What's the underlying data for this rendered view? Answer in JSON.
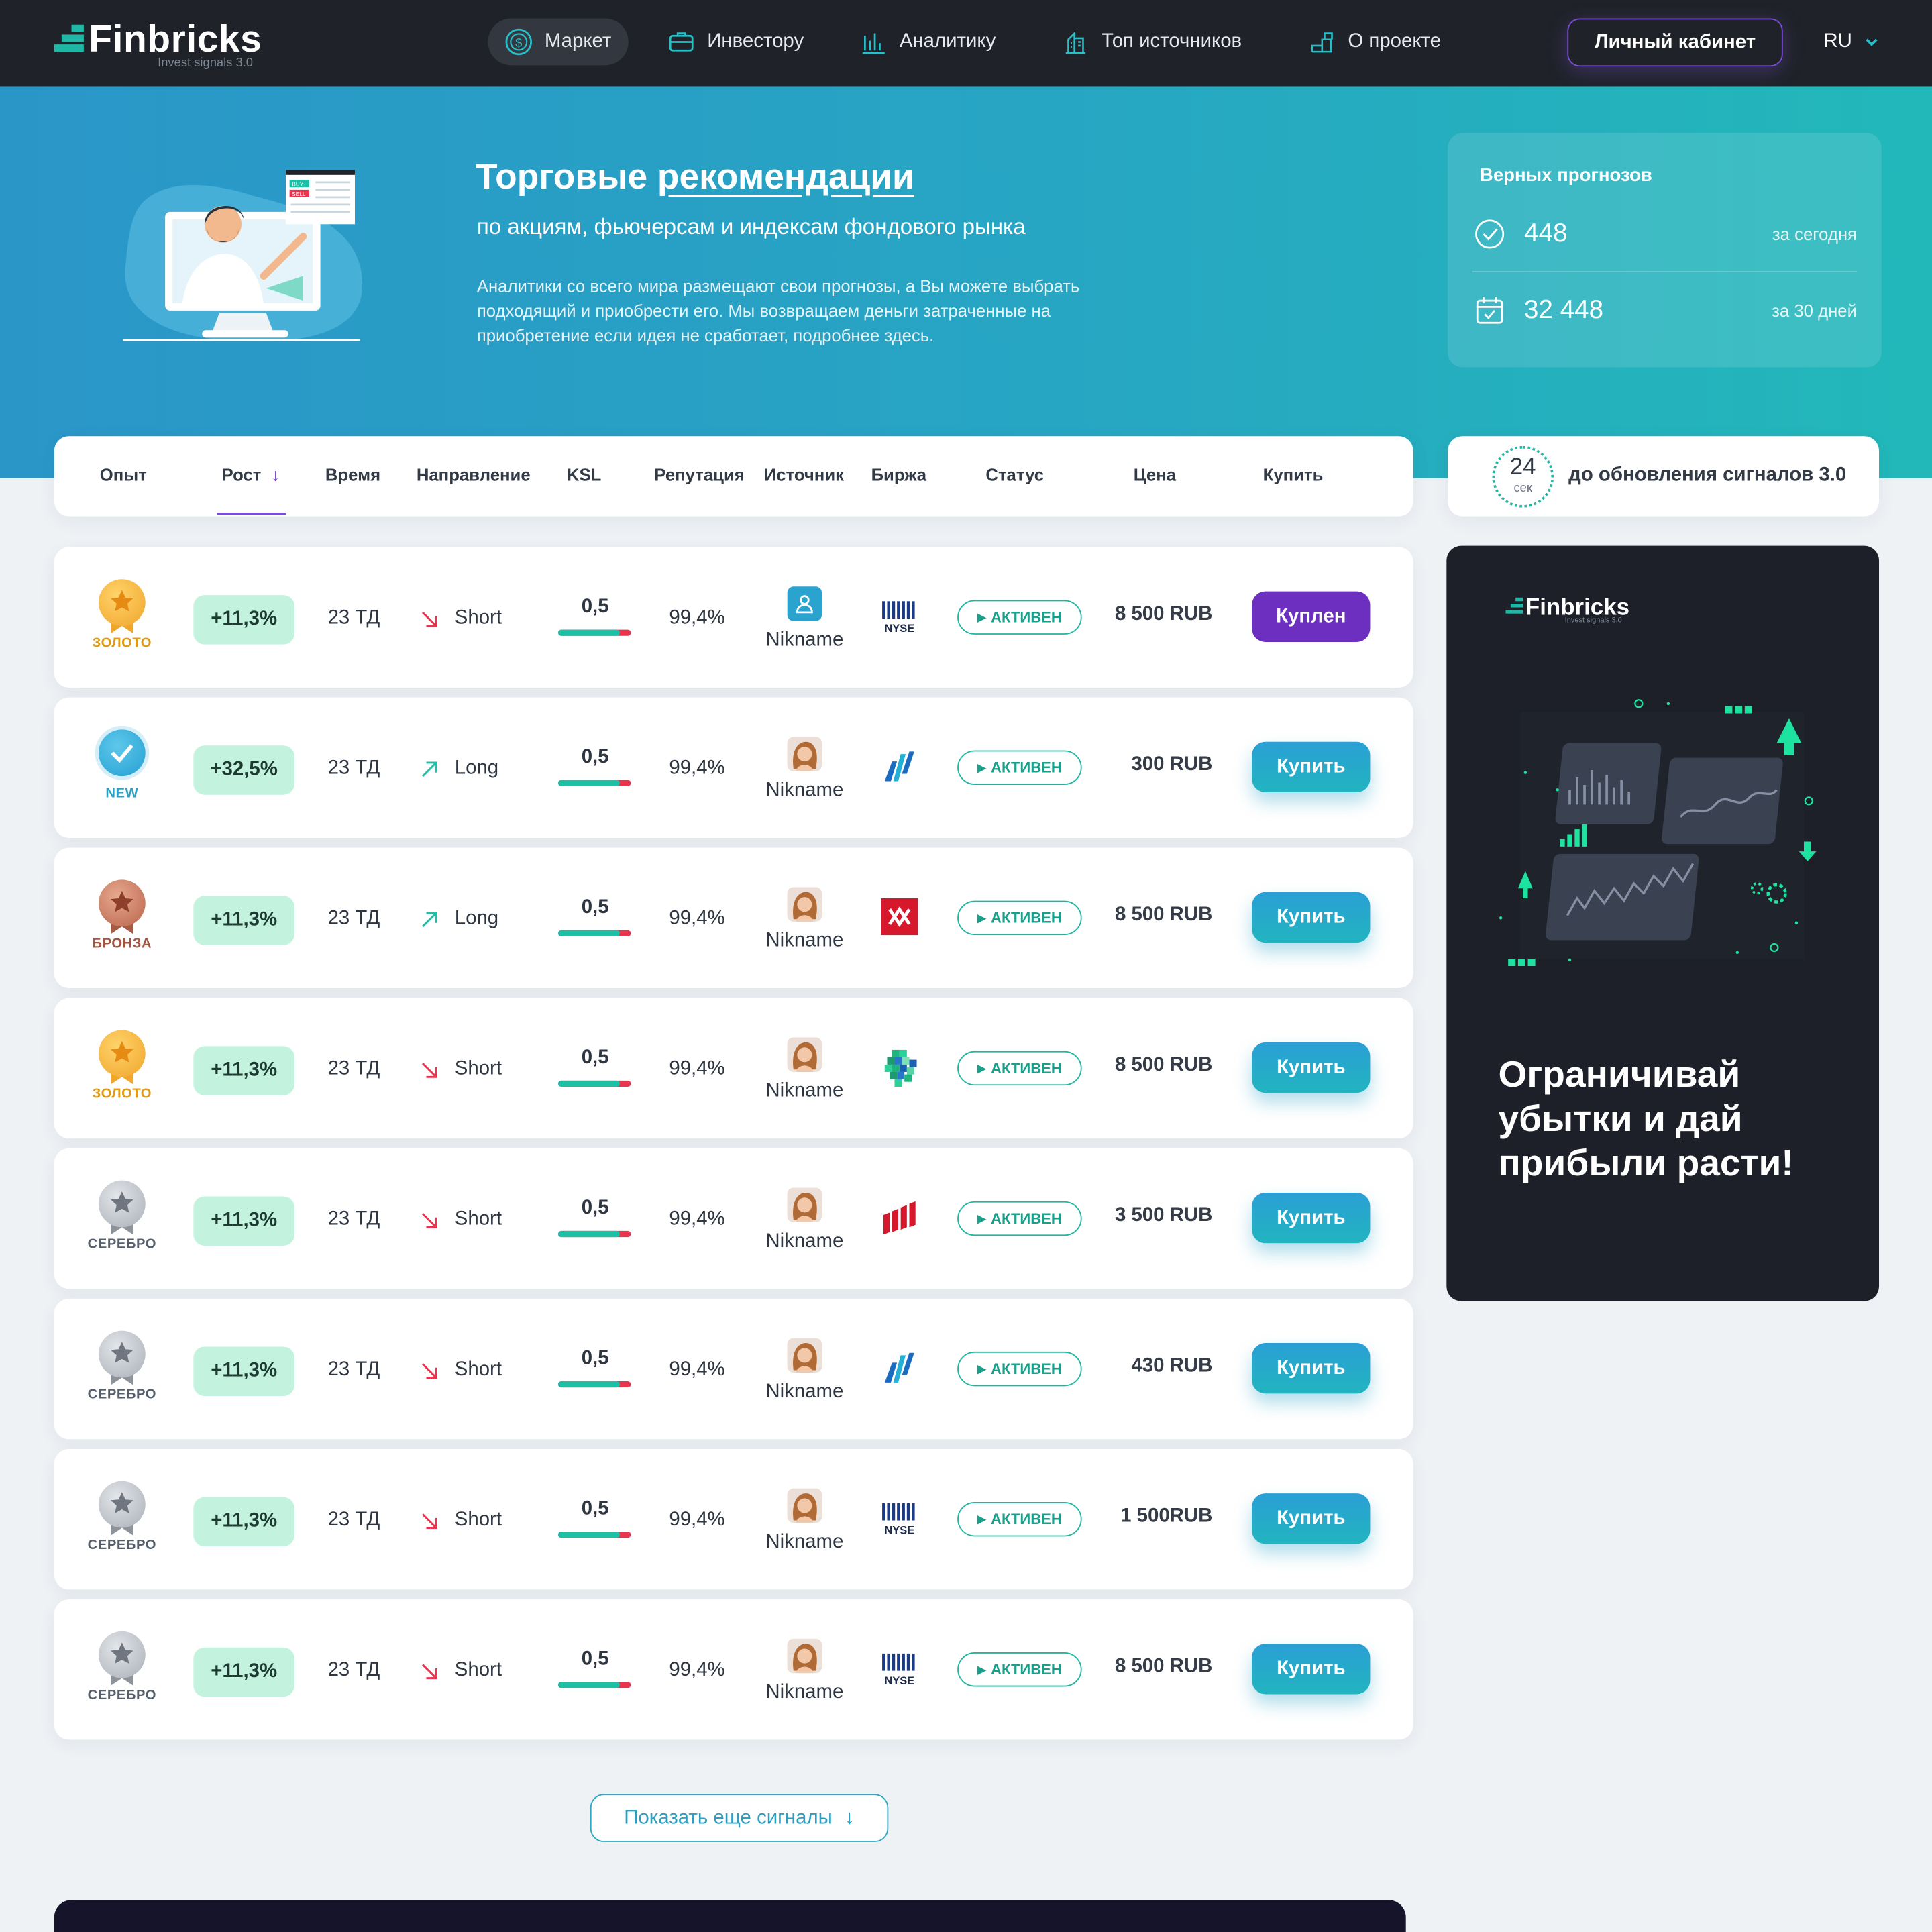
{
  "header": {
    "logo_text": "Finbricks",
    "logo_sub": "Invest signals 3.0",
    "nav": [
      {
        "label": "Маркет",
        "icon": "dollar-coin-icon"
      },
      {
        "label": "Инвестору",
        "icon": "briefcase-icon"
      },
      {
        "label": "Аналитику",
        "icon": "bar-chart-icon"
      },
      {
        "label": "Топ источников",
        "icon": "buildings-icon"
      },
      {
        "label": "О проекте",
        "icon": "info-stack-icon"
      }
    ],
    "cabinet_label": "Личный кабинет",
    "lang": "RU"
  },
  "hero": {
    "title_plain": "Торговые ",
    "title_link": "рекомендации",
    "subtitle": "по акциям, фьючерсам и индексам фондового рынка",
    "description": "Аналитики со всего мира размещают свои прогнозы, а Вы можете выбрать подходящий и приобрести его. Мы возвращаем деньги затраченные на приобретение если идея не сработает, подробнее здесь.",
    "illustration_labels": {
      "buy": "BUY",
      "sell": "SELL"
    }
  },
  "stats": {
    "title": "Верных прогнозов",
    "today_value": "448",
    "today_label": "за сегодня",
    "month_value": "32 448",
    "month_label": "за 30 дней"
  },
  "timer": {
    "value": "24",
    "unit": "сек",
    "text": "до обновления сигналов 3.0"
  },
  "table": {
    "columns": [
      "Опыт",
      "Рост",
      "Время",
      "Направление",
      "KSL",
      "Репутация",
      "Источник",
      "Биржа",
      "Статус",
      "Цена",
      "Купить"
    ],
    "sort_arrow": "↓",
    "rows": [
      {
        "medal": "gold",
        "level": "ЗОЛОТО",
        "growth": "+11,3%",
        "time": "23 ТД",
        "direction": "Short",
        "ksl": "0,5",
        "ksl_fill": 0.85,
        "reputation": "99,4%",
        "source": "Nikname",
        "source_avatar": "person-icon",
        "exchange": "nyse",
        "exchange_label": "NYSE",
        "status": "АКТИВЕН",
        "price": "8 500 RUB",
        "buy": "Куплен",
        "bought": true
      },
      {
        "medal": "new",
        "level": "NEW",
        "growth": "+32,5%",
        "time": "23 ТД",
        "direction": "Long",
        "ksl": "0,5",
        "ksl_fill": 0.85,
        "reputation": "99,4%",
        "source": "Nikname",
        "source_avatar": "photo",
        "exchange": "nasdaq",
        "exchange_label": "",
        "status": "АКТИВЕН",
        "price": "300 RUB",
        "buy": "Купить",
        "bought": false
      },
      {
        "medal": "bronze",
        "level": "БРОНЗА",
        "growth": "+11,3%",
        "time": "23 ТД",
        "direction": "Long",
        "ksl": "0,5",
        "ksl_fill": 0.85,
        "reputation": "99,4%",
        "source": "Nikname",
        "source_avatar": "photo",
        "exchange": "moex",
        "exchange_label": "",
        "status": "АКТИВЕН",
        "price": "8 500 RUB",
        "buy": "Купить",
        "bought": false
      },
      {
        "medal": "gold",
        "level": "ЗОЛОТО",
        "growth": "+11,3%",
        "time": "23 ТД",
        "direction": "Short",
        "ksl": "0,5",
        "ksl_fill": 0.85,
        "reputation": "99,4%",
        "source": "Nikname",
        "source_avatar": "photo",
        "exchange": "lse",
        "exchange_label": "",
        "status": "АКТИВЕН",
        "price": "8 500 RUB",
        "buy": "Купить",
        "bought": false
      },
      {
        "medal": "silver",
        "level": "СЕРЕБРО",
        "growth": "+11,3%",
        "time": "23 ТД",
        "direction": "Short",
        "ksl": "0,5",
        "ksl_fill": 0.85,
        "reputation": "99,4%",
        "source": "Nikname",
        "source_avatar": "photo",
        "exchange": "spb",
        "exchange_label": "",
        "status": "АКТИВЕН",
        "price": "3 500 RUB",
        "buy": "Купить",
        "bought": false
      },
      {
        "medal": "silver",
        "level": "СЕРЕБРО",
        "growth": "+11,3%",
        "time": "23 ТД",
        "direction": "Short",
        "ksl": "0,5",
        "ksl_fill": 0.85,
        "reputation": "99,4%",
        "source": "Nikname",
        "source_avatar": "photo",
        "exchange": "nasdaq",
        "exchange_label": "",
        "status": "АКТИВЕН",
        "price": "430 RUB",
        "buy": "Купить",
        "bought": false
      },
      {
        "medal": "silver",
        "level": "СЕРЕБРО",
        "growth": "+11,3%",
        "time": "23 ТД",
        "direction": "Short",
        "ksl": "0,5",
        "ksl_fill": 0.85,
        "reputation": "99,4%",
        "source": "Nikname",
        "source_avatar": "photo",
        "exchange": "nyse",
        "exchange_label": "NYSE",
        "status": "АКТИВЕН",
        "price": "1 500RUB",
        "buy": "Купить",
        "bought": false
      },
      {
        "medal": "silver",
        "level": "СЕРЕБРО",
        "growth": "+11,3%",
        "time": "23 ТД",
        "direction": "Short",
        "ksl": "0,5",
        "ksl_fill": 0.85,
        "reputation": "99,4%",
        "source": "Nikname",
        "source_avatar": "photo",
        "exchange": "nyse",
        "exchange_label": "NYSE",
        "status": "АКТИВЕН",
        "price": "8 500  RUB",
        "buy": "Купить",
        "bought": false
      }
    ]
  },
  "more_button": "Показать еще сигналы",
  "promo": {
    "logo": "Finbricks",
    "logo_sub": "Invest signals 3.0",
    "text": "Ограничивай убытки и дай прибыли расти!"
  },
  "colors": {
    "header_bg": "#1f2229",
    "accent_purple": "#6c2fc0",
    "accent_teal": "#1ec0a5",
    "buy_blue": "#2a9fd5",
    "ksl_red": "#e8344e",
    "growth_bg": "#c3f2df"
  }
}
